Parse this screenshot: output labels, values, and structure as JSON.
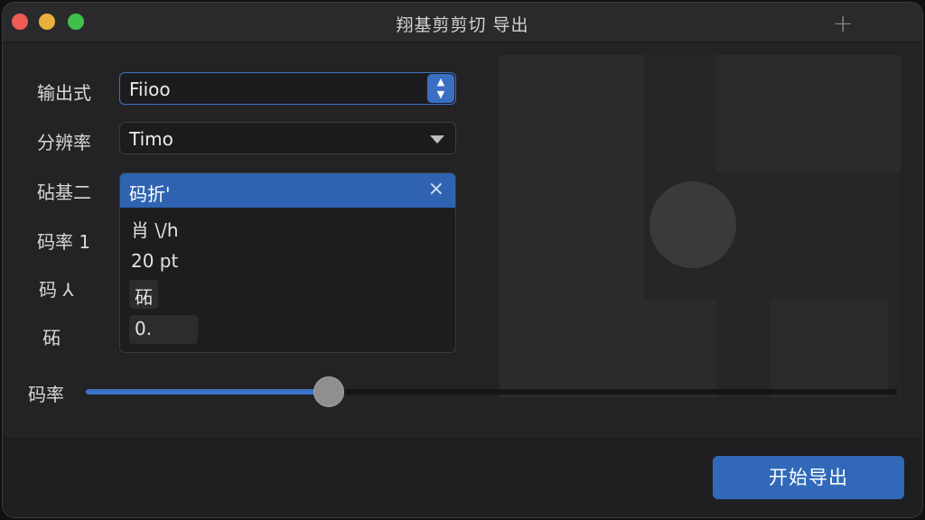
{
  "window": {
    "title": "翔基剪剪切  导出",
    "add_icon": "plus-icon"
  },
  "form": {
    "output_format": {
      "label": "输出式",
      "value": "Fiioo"
    },
    "resolution": {
      "label": "分辨率",
      "value": "Timo"
    },
    "field3": {
      "label": "砧基二",
      "selected": "码折'"
    },
    "bitrate1": {
      "label": "码率 1"
    },
    "field5": {
      "label": "码 ⅄"
    },
    "field6": {
      "label": "砳"
    },
    "list_items": [
      "肖 \\/h",
      "20 pt",
      "砳",
      "0."
    ]
  },
  "slider": {
    "label": "码率",
    "value": 0.3
  },
  "footer": {
    "export_label": "开始导出"
  },
  "colors": {
    "accent": "#3169b8",
    "background": "#232325"
  }
}
